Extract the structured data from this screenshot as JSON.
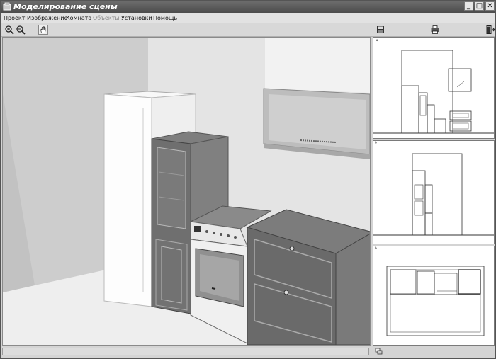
{
  "window": {
    "title": "Моделирование сцены",
    "controls": {
      "minimize": "_",
      "maximize": "□",
      "close": "✕"
    }
  },
  "menu": {
    "items": [
      {
        "label": "Проект",
        "enabled": true
      },
      {
        "label": "Изображение",
        "enabled": true
      },
      {
        "label": "Комната",
        "enabled": true
      },
      {
        "label": "Объекты",
        "enabled": false
      },
      {
        "label": "Установки",
        "enabled": true
      },
      {
        "label": "Помощь",
        "enabled": true
      }
    ]
  },
  "toolbar": {
    "icons": [
      "zoom-in-icon",
      "zoom-out-icon",
      "hand-pan-icon",
      "save-disk-icon",
      "print-icon",
      "exit-icon"
    ]
  },
  "viewports": {
    "markers": [
      "×",
      "ᵇ",
      "ᵇ"
    ]
  },
  "colors": {
    "title_bar": "#555555",
    "window_face": "#d4d4d4",
    "viewport_bg": "#ffffff"
  }
}
